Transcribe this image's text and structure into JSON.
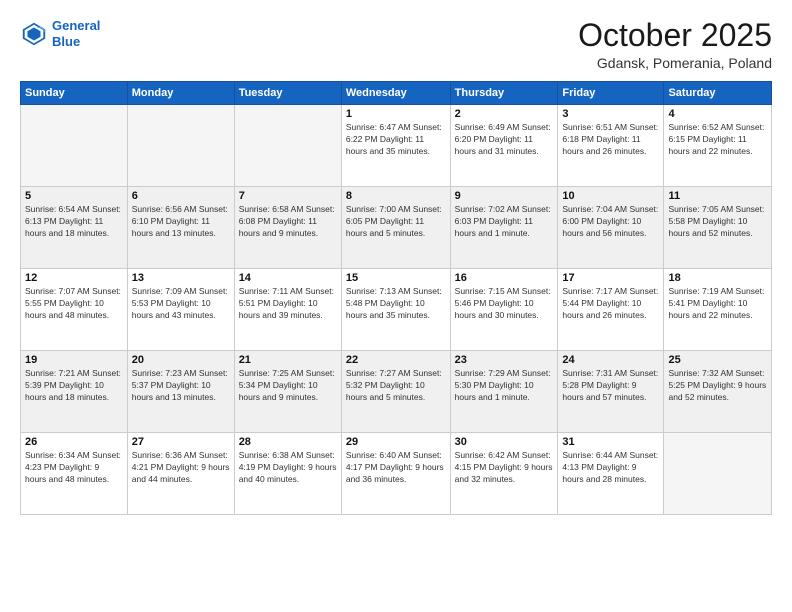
{
  "header": {
    "logo_line1": "General",
    "logo_line2": "Blue",
    "month": "October 2025",
    "location": "Gdansk, Pomerania, Poland"
  },
  "weekdays": [
    "Sunday",
    "Monday",
    "Tuesday",
    "Wednesday",
    "Thursday",
    "Friday",
    "Saturday"
  ],
  "weeks": [
    {
      "shade": false,
      "days": [
        {
          "num": "",
          "info": ""
        },
        {
          "num": "",
          "info": ""
        },
        {
          "num": "",
          "info": ""
        },
        {
          "num": "1",
          "info": "Sunrise: 6:47 AM\nSunset: 6:22 PM\nDaylight: 11 hours\nand 35 minutes."
        },
        {
          "num": "2",
          "info": "Sunrise: 6:49 AM\nSunset: 6:20 PM\nDaylight: 11 hours\nand 31 minutes."
        },
        {
          "num": "3",
          "info": "Sunrise: 6:51 AM\nSunset: 6:18 PM\nDaylight: 11 hours\nand 26 minutes."
        },
        {
          "num": "4",
          "info": "Sunrise: 6:52 AM\nSunset: 6:15 PM\nDaylight: 11 hours\nand 22 minutes."
        }
      ]
    },
    {
      "shade": true,
      "days": [
        {
          "num": "5",
          "info": "Sunrise: 6:54 AM\nSunset: 6:13 PM\nDaylight: 11 hours\nand 18 minutes."
        },
        {
          "num": "6",
          "info": "Sunrise: 6:56 AM\nSunset: 6:10 PM\nDaylight: 11 hours\nand 13 minutes."
        },
        {
          "num": "7",
          "info": "Sunrise: 6:58 AM\nSunset: 6:08 PM\nDaylight: 11 hours\nand 9 minutes."
        },
        {
          "num": "8",
          "info": "Sunrise: 7:00 AM\nSunset: 6:05 PM\nDaylight: 11 hours\nand 5 minutes."
        },
        {
          "num": "9",
          "info": "Sunrise: 7:02 AM\nSunset: 6:03 PM\nDaylight: 11 hours\nand 1 minute."
        },
        {
          "num": "10",
          "info": "Sunrise: 7:04 AM\nSunset: 6:00 PM\nDaylight: 10 hours\nand 56 minutes."
        },
        {
          "num": "11",
          "info": "Sunrise: 7:05 AM\nSunset: 5:58 PM\nDaylight: 10 hours\nand 52 minutes."
        }
      ]
    },
    {
      "shade": false,
      "days": [
        {
          "num": "12",
          "info": "Sunrise: 7:07 AM\nSunset: 5:55 PM\nDaylight: 10 hours\nand 48 minutes."
        },
        {
          "num": "13",
          "info": "Sunrise: 7:09 AM\nSunset: 5:53 PM\nDaylight: 10 hours\nand 43 minutes."
        },
        {
          "num": "14",
          "info": "Sunrise: 7:11 AM\nSunset: 5:51 PM\nDaylight: 10 hours\nand 39 minutes."
        },
        {
          "num": "15",
          "info": "Sunrise: 7:13 AM\nSunset: 5:48 PM\nDaylight: 10 hours\nand 35 minutes."
        },
        {
          "num": "16",
          "info": "Sunrise: 7:15 AM\nSunset: 5:46 PM\nDaylight: 10 hours\nand 30 minutes."
        },
        {
          "num": "17",
          "info": "Sunrise: 7:17 AM\nSunset: 5:44 PM\nDaylight: 10 hours\nand 26 minutes."
        },
        {
          "num": "18",
          "info": "Sunrise: 7:19 AM\nSunset: 5:41 PM\nDaylight: 10 hours\nand 22 minutes."
        }
      ]
    },
    {
      "shade": true,
      "days": [
        {
          "num": "19",
          "info": "Sunrise: 7:21 AM\nSunset: 5:39 PM\nDaylight: 10 hours\nand 18 minutes."
        },
        {
          "num": "20",
          "info": "Sunrise: 7:23 AM\nSunset: 5:37 PM\nDaylight: 10 hours\nand 13 minutes."
        },
        {
          "num": "21",
          "info": "Sunrise: 7:25 AM\nSunset: 5:34 PM\nDaylight: 10 hours\nand 9 minutes."
        },
        {
          "num": "22",
          "info": "Sunrise: 7:27 AM\nSunset: 5:32 PM\nDaylight: 10 hours\nand 5 minutes."
        },
        {
          "num": "23",
          "info": "Sunrise: 7:29 AM\nSunset: 5:30 PM\nDaylight: 10 hours\nand 1 minute."
        },
        {
          "num": "24",
          "info": "Sunrise: 7:31 AM\nSunset: 5:28 PM\nDaylight: 9 hours\nand 57 minutes."
        },
        {
          "num": "25",
          "info": "Sunrise: 7:32 AM\nSunset: 5:25 PM\nDaylight: 9 hours\nand 52 minutes."
        }
      ]
    },
    {
      "shade": false,
      "days": [
        {
          "num": "26",
          "info": "Sunrise: 6:34 AM\nSunset: 4:23 PM\nDaylight: 9 hours\nand 48 minutes."
        },
        {
          "num": "27",
          "info": "Sunrise: 6:36 AM\nSunset: 4:21 PM\nDaylight: 9 hours\nand 44 minutes."
        },
        {
          "num": "28",
          "info": "Sunrise: 6:38 AM\nSunset: 4:19 PM\nDaylight: 9 hours\nand 40 minutes."
        },
        {
          "num": "29",
          "info": "Sunrise: 6:40 AM\nSunset: 4:17 PM\nDaylight: 9 hours\nand 36 minutes."
        },
        {
          "num": "30",
          "info": "Sunrise: 6:42 AM\nSunset: 4:15 PM\nDaylight: 9 hours\nand 32 minutes."
        },
        {
          "num": "31",
          "info": "Sunrise: 6:44 AM\nSunset: 4:13 PM\nDaylight: 9 hours\nand 28 minutes."
        },
        {
          "num": "",
          "info": ""
        }
      ]
    }
  ]
}
